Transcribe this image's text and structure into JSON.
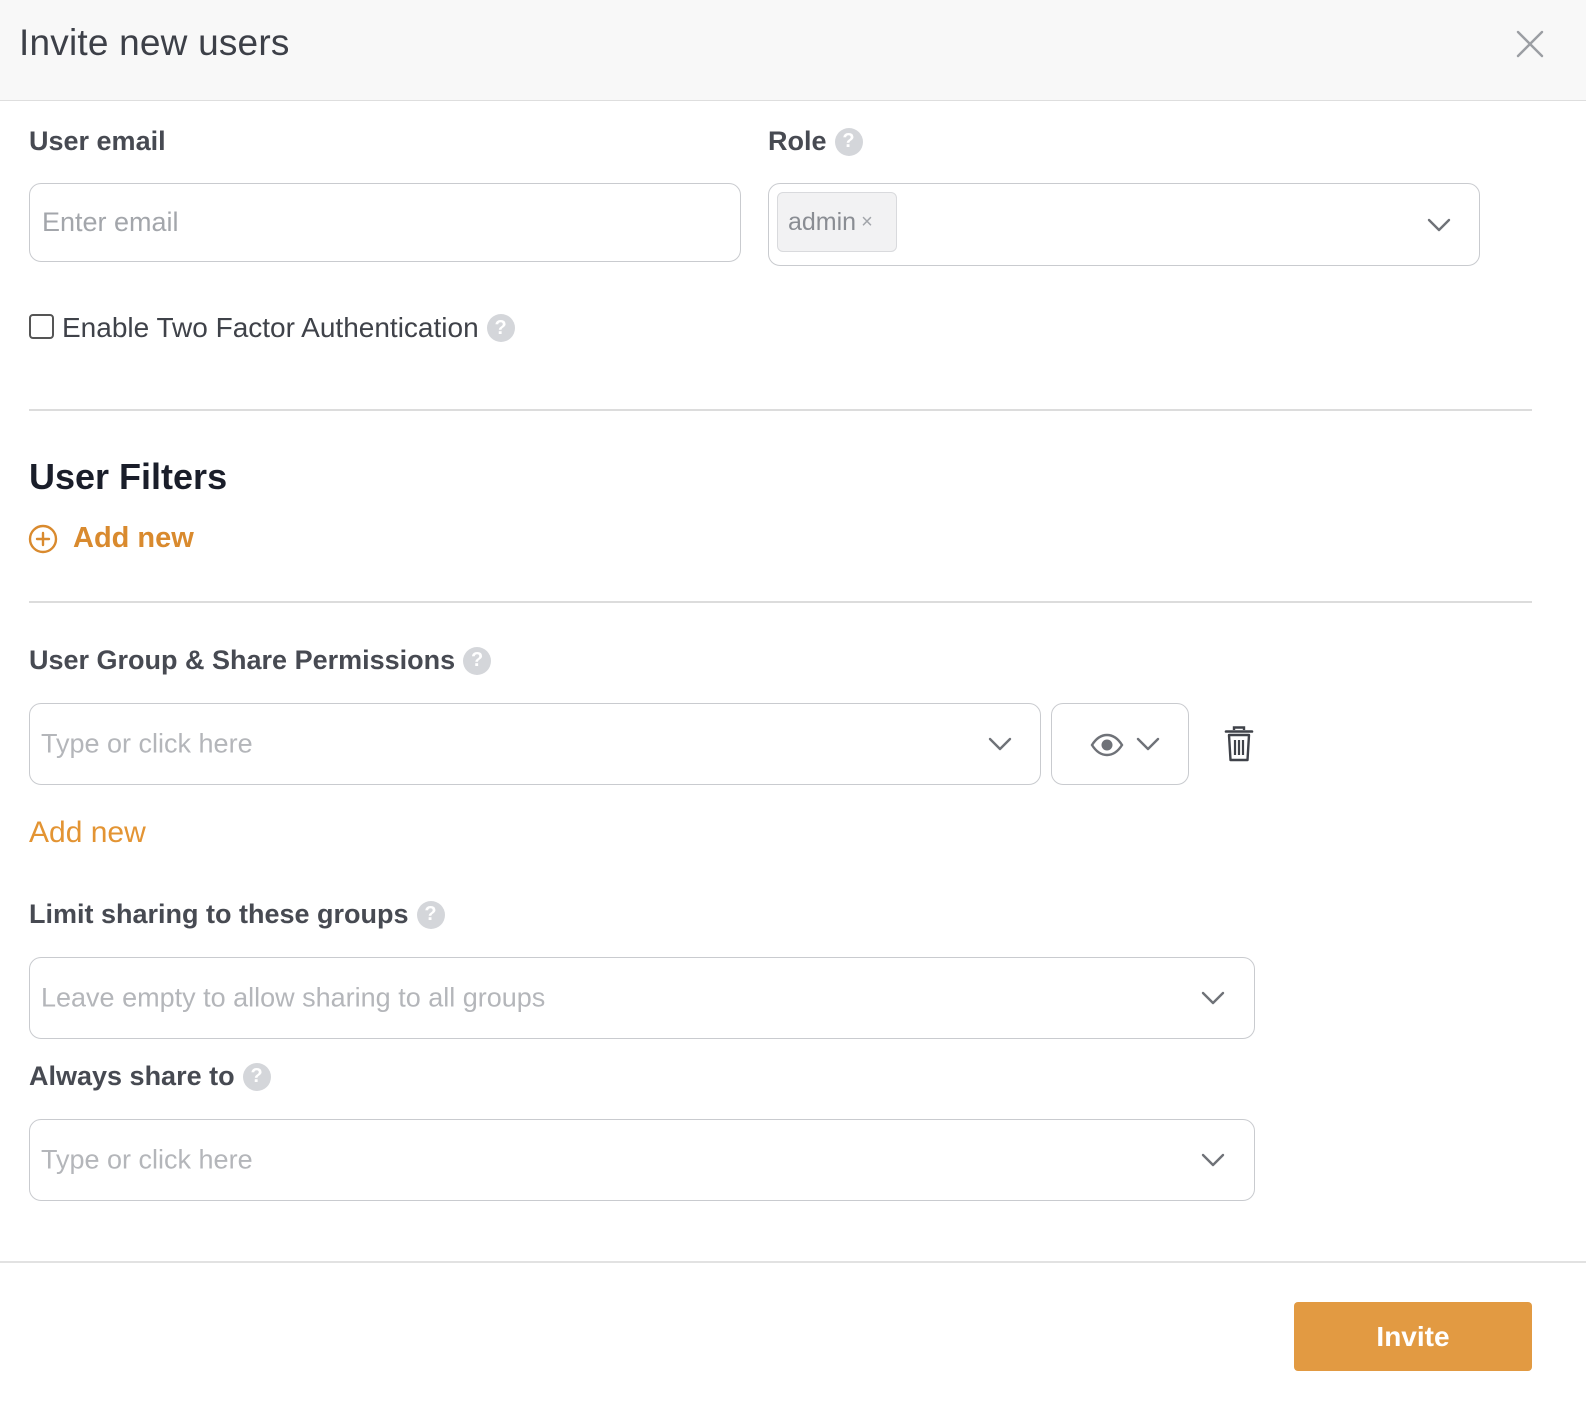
{
  "modal": {
    "title": "Invite new users",
    "close_icon": "close-icon"
  },
  "user_email": {
    "label": "User email",
    "placeholder": "Enter email",
    "value": ""
  },
  "role": {
    "label": "Role",
    "selected_tag": "admin",
    "tag_remove_glyph": "×"
  },
  "two_factor": {
    "label": "Enable Two Factor Authentication",
    "checked": false
  },
  "user_filters": {
    "title": "User Filters",
    "add_new_label": "Add new"
  },
  "group_permissions": {
    "label": "User Group & Share Permissions",
    "group_placeholder": "Type or click here",
    "permission_icon": "eye-icon",
    "add_new_label": "Add new"
  },
  "limit_sharing": {
    "label": "Limit sharing to these groups",
    "placeholder": "Leave empty to allow sharing to all groups"
  },
  "always_share": {
    "label": "Always share to",
    "placeholder": "Type or click here"
  },
  "footer": {
    "invite_label": "Invite"
  },
  "colors": {
    "accent": "#e29a42",
    "accent_text": "#d98a2e",
    "header_bg": "#f8f8f8",
    "help_icon": "#d4d6da"
  },
  "help_glyph": "?"
}
